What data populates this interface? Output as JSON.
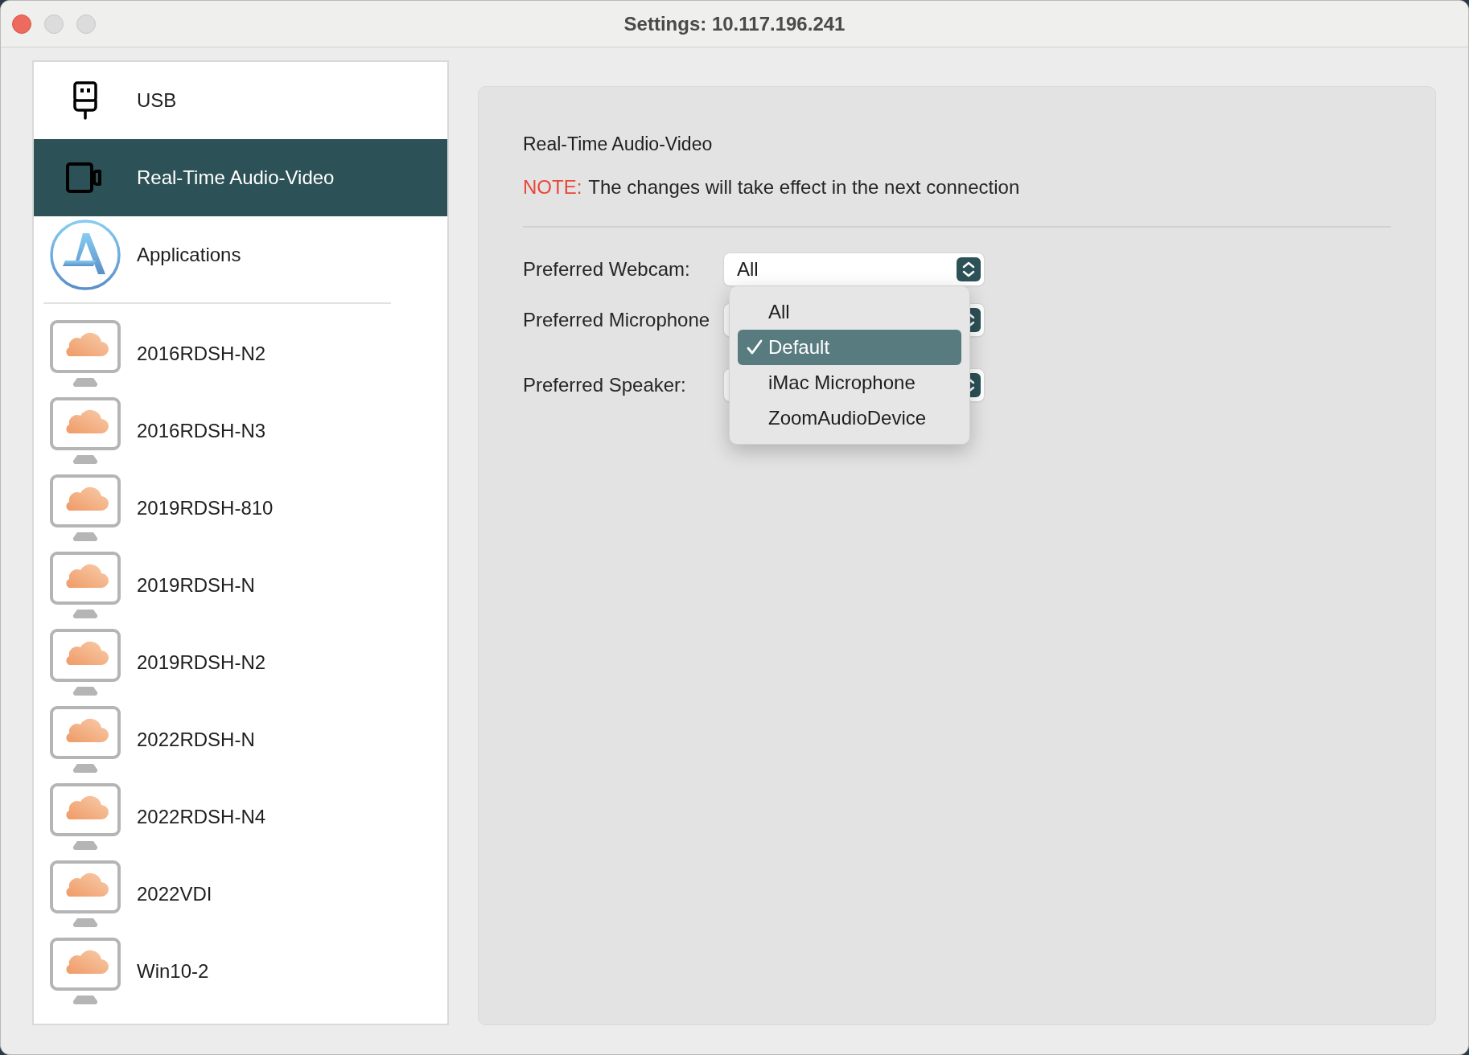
{
  "window": {
    "title": "Settings: 10.117.196.241"
  },
  "sidebar": {
    "items": [
      {
        "kind": "usb",
        "label": "USB",
        "selected": false
      },
      {
        "kind": "video",
        "label": "Real-Time Audio-Video",
        "selected": true
      },
      {
        "kind": "apps",
        "label": "Applications",
        "selected": false
      }
    ],
    "desktops": [
      {
        "label": "2016RDSH-N2"
      },
      {
        "label": "2016RDSH-N3"
      },
      {
        "label": "2019RDSH-810"
      },
      {
        "label": "2019RDSH-N"
      },
      {
        "label": "2019RDSH-N2"
      },
      {
        "label": "2022RDSH-N"
      },
      {
        "label": "2022RDSH-N4"
      },
      {
        "label": "2022VDI"
      },
      {
        "label": "Win10-2"
      }
    ]
  },
  "panel": {
    "title": "Real-Time Audio-Video",
    "note": {
      "prefix": "NOTE:",
      "text": "The changes will take effect in the next connection"
    },
    "fields": [
      {
        "label": "Preferred Webcam:",
        "value": "All"
      },
      {
        "label": "Preferred Microphone"
      },
      {
        "label": "Preferred Speaker:"
      }
    ],
    "dropdown": {
      "options": [
        {
          "label": "All",
          "selected": false
        },
        {
          "label": "Default",
          "selected": true
        },
        {
          "label": "iMac Microphone",
          "selected": false
        },
        {
          "label": "ZoomAudioDevice",
          "selected": false
        }
      ]
    }
  }
}
